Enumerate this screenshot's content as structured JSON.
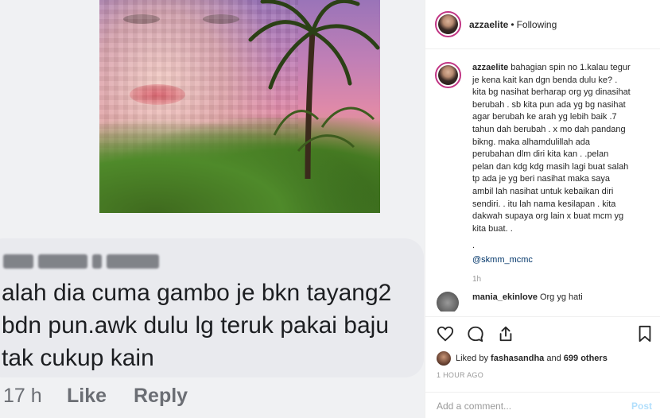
{
  "left_image": {
    "fb_comment": {
      "text": "alah dia cuma gambo je bkn tayang2 bdn pun.awk dulu lg teruk pakai baju tak cukup kain",
      "time": "17 h",
      "like_label": "Like",
      "reply_label": "Reply"
    }
  },
  "header": {
    "username": "azzaelite",
    "separator": "•",
    "follow_status": "Following"
  },
  "caption": {
    "username": "azzaelite",
    "text": "bahagian spin no 1.kalau tegur je kena kait kan dgn benda dulu ke? . kita bg nasihat berharap org yg dinasihat berubah . sb kita pun ada yg bg nasihat agar berubah ke arah yg lebih baik .7 tahun dah berubah . x mo dah pandang bikng. maka alhamdulillah ada perubahan dlm diri kita kan . .pelan pelan dan kdg kdg masih lagi buat salah tp ada je yg beri nasihat maka saya ambil lah nasihat untuk kebaikan diri sendiri. . itu lah nama kesilapan . kita dakwah supaya org lain x buat mcm yg kita buat. .",
    "dot": ".",
    "mention": "@skmm_mcmc",
    "time": "1h"
  },
  "next_comment": {
    "username": "mania_ekinlove",
    "text": "Org yg hati"
  },
  "actions": {
    "liked_by_prefix": "Liked by",
    "liked_by_user": "fashasandha",
    "liked_by_suffix": "and",
    "others": "699 others",
    "timestamp": "1 HOUR AGO",
    "add_comment_placeholder": "Add a comment...",
    "post_label": "Post"
  },
  "colors": {
    "story_ring": "#c13584",
    "mention": "#003569",
    "post_disabled": "#b2dffc",
    "fb_bubble": "#e9eaee"
  },
  "icons": [
    "heart-icon",
    "comment-icon",
    "share-icon",
    "bookmark-icon"
  ]
}
